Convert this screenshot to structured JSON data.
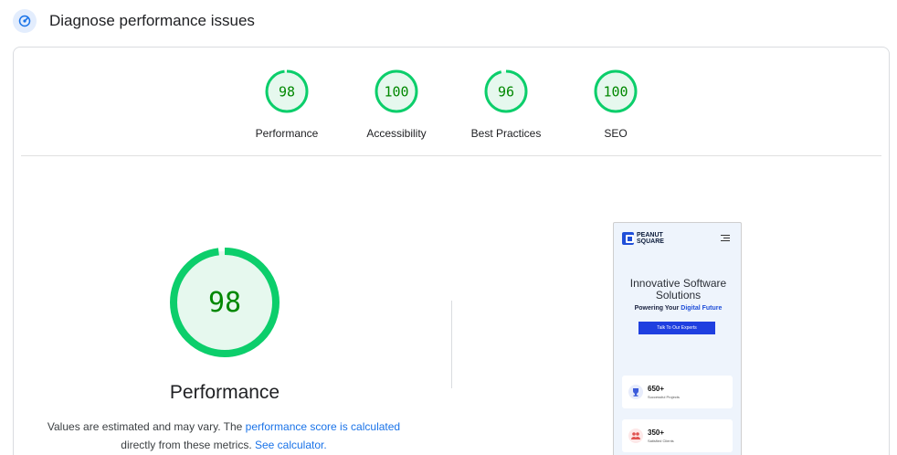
{
  "header": {
    "title": "Diagnose performance issues",
    "icon": "speed-gauge-icon",
    "icon_color": "#1a73e8"
  },
  "gauges": [
    {
      "score": 98,
      "label": "Performance"
    },
    {
      "score": 100,
      "label": "Accessibility"
    },
    {
      "score": 96,
      "label": "Best Practices"
    },
    {
      "score": 100,
      "label": "SEO"
    }
  ],
  "colors": {
    "pass_stroke": "#0cce6b",
    "pass_fill": "#e6f8ee",
    "pass_text": "#008800",
    "link": "#1a73e8"
  },
  "performance": {
    "score": 98,
    "label": "Performance",
    "desc_text1": "Values are estimated and may vary. The ",
    "desc_link1": "performance score is calculated",
    "desc_text2": "directly from these metrics. ",
    "desc_link2": "See calculator."
  },
  "preview": {
    "logo_line1": "PEANUT",
    "logo_line2": "SQUARE",
    "headline": "Innovative Software Solutions",
    "sub_prefix": "Powering Your ",
    "sub_highlight": "Digital Future",
    "button": "Talk To Our Experts",
    "stats": [
      {
        "value": "650+",
        "caption": "Successful Projects",
        "icon": "trophy-icon"
      },
      {
        "value": "350+",
        "caption": "Satisfied Clients",
        "icon": "users-icon"
      }
    ]
  }
}
